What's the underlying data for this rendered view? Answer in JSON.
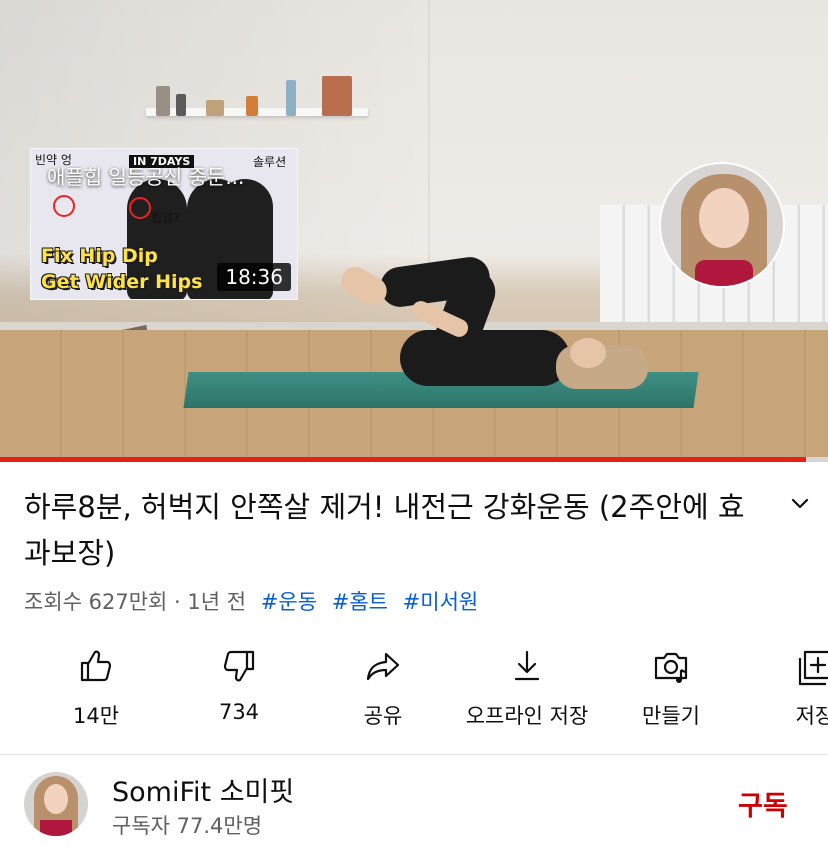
{
  "player": {
    "progress_fraction": 0.973,
    "end_card": {
      "title": "애플힙 일등공신 중둔...",
      "duration": "18:36",
      "thumbnail_text": {
        "tag": "IN 7DAYS",
        "note_left": "빈약 엉",
        "note_right": "솔루션",
        "note_mid": "힙덥?",
        "line1": "Fix Hip Dip",
        "line2": "Get Wider Hips"
      }
    }
  },
  "video": {
    "title": "하루8분, 허벅지 안쪽살 제거! 내전근 강화운동 (2주안에 효과보장)",
    "views": "조회수 627만회",
    "separator": "·",
    "age": "1년 전",
    "hashtags": [
      "#운동",
      "#홈트",
      "#미서원"
    ]
  },
  "actions": [
    {
      "label": "14만",
      "icon": "like-icon"
    },
    {
      "label": "734",
      "icon": "dislike-icon"
    },
    {
      "label": "공유",
      "icon": "share-icon"
    },
    {
      "label": "오프라인 저장",
      "icon": "download-icon"
    },
    {
      "label": "만들기",
      "icon": "create-icon"
    },
    {
      "label": "저장",
      "icon": "save-playlist-icon"
    }
  ],
  "channel": {
    "name": "SomiFit 소미핏",
    "subscribers": "구독자 77.4만명",
    "subscribe_label": "구독"
  },
  "colors": {
    "accent_red": "#cc0000",
    "progress_red": "#e62117",
    "link_blue": "#065fd4",
    "secondary_text": "#606060"
  }
}
